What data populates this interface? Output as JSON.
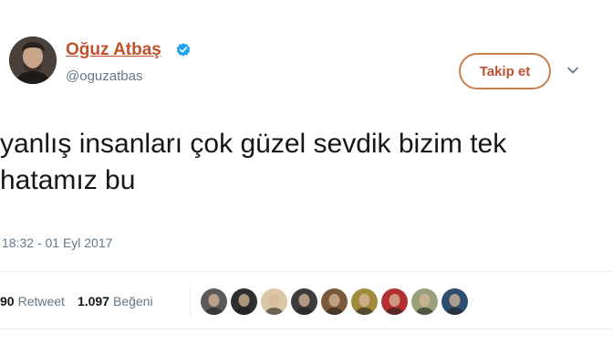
{
  "user": {
    "display_name": "Oğuz Atbaş",
    "handle": "@oguzatbas",
    "verified": true
  },
  "follow_button": {
    "label": "Takip et"
  },
  "tweet": {
    "text_lines": [
      "yanlış insanları çok güzel sevdik bizim tek",
      "hatamız bu"
    ],
    "timestamp": "18:32 - 01 Eyl 2017"
  },
  "stats": {
    "retweet_count": "90",
    "retweet_label": "Retweet",
    "like_count": "1.097",
    "like_label": "Beğeni"
  },
  "likers": [
    {
      "color": "#5b5b5b"
    },
    {
      "color": "#2e2e2e"
    },
    {
      "color": "#d9c7a5"
    },
    {
      "color": "#3c3c3c"
    },
    {
      "color": "#7a5a3a"
    },
    {
      "color": "#a08a3c"
    },
    {
      "color": "#b33030"
    },
    {
      "color": "#9aa07a"
    },
    {
      "color": "#2d4e6e"
    }
  ],
  "colors": {
    "accent": "#c0512d",
    "verified": "#1da1f2",
    "muted": "#657786"
  }
}
